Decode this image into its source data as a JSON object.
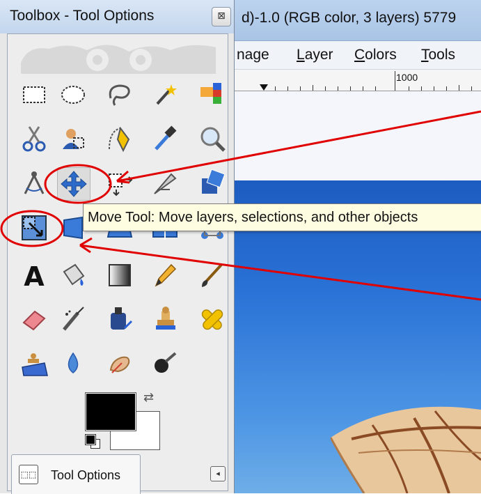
{
  "toolbox": {
    "title": "Toolbox - Tool Options",
    "close_glyph": "⊠",
    "tools": [
      {
        "name": "rect-select-tool",
        "icon": "rect-select-icon"
      },
      {
        "name": "ellipse-select-tool",
        "icon": "ellipse-select-icon"
      },
      {
        "name": "free-select-tool",
        "icon": "lasso-icon"
      },
      {
        "name": "fuzzy-select-tool",
        "icon": "magic-wand-icon"
      },
      {
        "name": "select-by-color-tool",
        "icon": "color-select-icon"
      },
      {
        "name": "scissors-select-tool",
        "icon": "scissors-icon"
      },
      {
        "name": "foreground-select-tool",
        "icon": "foreground-select-icon"
      },
      {
        "name": "paths-tool",
        "icon": "pen-path-icon"
      },
      {
        "name": "color-picker-tool",
        "icon": "eyedropper-icon"
      },
      {
        "name": "zoom-tool",
        "icon": "magnifier-icon"
      },
      {
        "name": "measure-tool",
        "icon": "compass-icon"
      },
      {
        "name": "move-tool",
        "icon": "move-arrows-icon"
      },
      {
        "name": "align-tool",
        "icon": "align-icon"
      },
      {
        "name": "crop-tool",
        "icon": "crop-knife-icon"
      },
      {
        "name": "rotate-tool",
        "icon": "rotate-icon"
      },
      {
        "name": "scale-tool",
        "icon": "scale-icon"
      },
      {
        "name": "shear-tool",
        "icon": "shear-icon"
      },
      {
        "name": "perspective-tool",
        "icon": "perspective-icon"
      },
      {
        "name": "flip-tool",
        "icon": "flip-icon"
      },
      {
        "name": "cage-transform-tool",
        "icon": "cage-icon"
      },
      {
        "name": "text-tool",
        "icon": "text-a-icon"
      },
      {
        "name": "bucket-fill-tool",
        "icon": "paint-bucket-icon"
      },
      {
        "name": "blend-tool",
        "icon": "gradient-icon"
      },
      {
        "name": "pencil-tool",
        "icon": "pencil-icon"
      },
      {
        "name": "paintbrush-tool",
        "icon": "paintbrush-icon"
      },
      {
        "name": "eraser-tool",
        "icon": "eraser-icon"
      },
      {
        "name": "airbrush-tool",
        "icon": "airbrush-icon"
      },
      {
        "name": "ink-tool",
        "icon": "ink-bottle-icon"
      },
      {
        "name": "clone-tool",
        "icon": "clone-stamp-icon"
      },
      {
        "name": "heal-tool",
        "icon": "heal-bandage-icon"
      },
      {
        "name": "perspective-clone-tool",
        "icon": "perspective-clone-icon"
      },
      {
        "name": "blur-sharpen-tool",
        "icon": "water-drop-icon"
      },
      {
        "name": "smudge-tool",
        "icon": "smudge-finger-icon"
      },
      {
        "name": "dodge-burn-tool",
        "icon": "dodge-burn-icon"
      }
    ],
    "colors": {
      "foreground": "#000000",
      "background": "#ffffff",
      "swap_glyph": "⇄"
    },
    "tab_label": "Tool Options",
    "tab_icon_glyph": "⬚⬚",
    "tab_menu_glyph": "◂"
  },
  "image_window": {
    "title": "d)-1.0 (RGB color, 3 layers) 5779",
    "menu": [
      {
        "label": "nage",
        "underline_index": -1
      },
      {
        "label": "Layer",
        "underline_index": 0
      },
      {
        "label": "Colors",
        "underline_index": 0
      },
      {
        "label": "Tools",
        "underline_index": 0
      }
    ],
    "ruler_label": "1000"
  },
  "tooltip": {
    "text": "Move Tool: Move layers, selections, and other objects"
  },
  "annotation_color": "#e00000"
}
